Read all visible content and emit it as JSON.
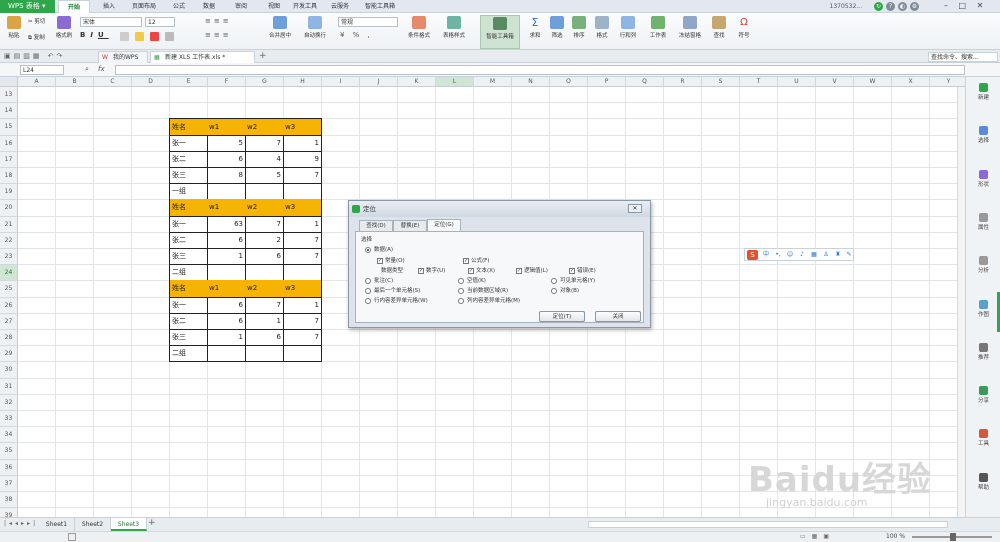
{
  "app": {
    "name": "WPS 表格",
    "account": "1370532...",
    "brand_color": "#2ea64a",
    "header_fill": "#f6b400"
  },
  "menu": [
    "开始",
    "插入",
    "页面布局",
    "公式",
    "数据",
    "审阅",
    "视图",
    "开发工具",
    "云服务",
    "智能工具箱"
  ],
  "ribbon": {
    "paste": "粘贴",
    "cut": "剪切",
    "copy": "复制",
    "format_painter": "格式刷",
    "font_name": "宋体",
    "font_size": "12",
    "merge_center": "合并居中",
    "wrap_text": "自动换行",
    "number_format": "常规",
    "conditional_format": "条件格式",
    "table_style": "表格样式",
    "smart_toolbox": "智能工具箱",
    "sum": "求和",
    "filter": "筛选",
    "sort": "排序",
    "format": "格式",
    "row_col": "行和列",
    "worksheet": "工作表",
    "freeze": "冻结窗格",
    "find": "查找",
    "symbol": "符号",
    "search_cmd": "查找命令、搜索..."
  },
  "doc_tabs": {
    "home": "我的WPS",
    "active": "新建 XLS 工作表.xls *"
  },
  "formula_bar": {
    "name_box": "L24",
    "fx": "fx"
  },
  "columns": [
    "A",
    "B",
    "C",
    "D",
    "E",
    "F",
    "G",
    "H",
    "I",
    "J",
    "K",
    "L",
    "M",
    "N",
    "O",
    "P",
    "Q",
    "R",
    "S",
    "T",
    "U",
    "V",
    "W",
    "X",
    "Y"
  ],
  "selected_column": "L",
  "rows": [
    "13",
    "14",
    "15",
    "16",
    "17",
    "18",
    "19",
    "20",
    "21",
    "22",
    "23",
    "24",
    "25",
    "26",
    "27",
    "28",
    "29",
    "30",
    "31",
    "32",
    "33",
    "34",
    "35",
    "36",
    "37",
    "38",
    "39"
  ],
  "selected_row": "24",
  "table": [
    {
      "row": "15",
      "cells": [
        "姓名",
        "w1",
        "w2",
        "w3"
      ],
      "header": true
    },
    {
      "row": "16",
      "cells": [
        "张一",
        "5",
        "7",
        "1"
      ]
    },
    {
      "row": "17",
      "cells": [
        "张二",
        "6",
        "4",
        "9"
      ]
    },
    {
      "row": "18",
      "cells": [
        "张三",
        "8",
        "5",
        "7"
      ]
    },
    {
      "row": "19",
      "cells": [
        "一组",
        "",
        "",
        ""
      ]
    },
    {
      "row": "20",
      "cells": [
        "姓名",
        "w1",
        "w2",
        "w3"
      ],
      "header": true
    },
    {
      "row": "21",
      "cells": [
        "张一",
        "63",
        "7",
        "1"
      ]
    },
    {
      "row": "22",
      "cells": [
        "张二",
        "6",
        "2",
        "7"
      ]
    },
    {
      "row": "23",
      "cells": [
        "张三",
        "1",
        "6",
        "7"
      ]
    },
    {
      "row": "24",
      "cells": [
        "二组",
        "",
        "",
        ""
      ]
    },
    {
      "row": "25",
      "cells": [
        "姓名",
        "w1",
        "w2",
        "w3"
      ],
      "header": true
    },
    {
      "row": "26",
      "cells": [
        "张一",
        "6",
        "7",
        "1"
      ]
    },
    {
      "row": "27",
      "cells": [
        "张二",
        "6",
        "1",
        "7"
      ]
    },
    {
      "row": "28",
      "cells": [
        "张三",
        "1",
        "6",
        "7"
      ]
    },
    {
      "row": "29",
      "cells": [
        "二组",
        "",
        "",
        ""
      ]
    }
  ],
  "dialog": {
    "title": "定位",
    "tabs": [
      "查找(D)",
      "替换(E)",
      "定位(G)"
    ],
    "group_label": "选择",
    "data_option": "数据(A)",
    "constants": "常量(O)",
    "formulas": "公式(F)",
    "data_type": "数据类型",
    "types": [
      "数字(U)",
      "文本(X)",
      "逻辑值(L)",
      "错误(E)"
    ],
    "options": [
      "批注(C)",
      "空值(K)",
      "可见单元格(Y)",
      "最后一个单元格(S)",
      "当前数据区域(R)",
      "对象(B)",
      "行内容差异单元格(W)",
      "列内容差异单元格(M)"
    ],
    "ok": "定位(T)",
    "close": "关闭"
  },
  "sidebar": [
    "新建",
    "选择",
    "形状",
    "属性",
    "分析",
    "作图",
    "推荐",
    "分享",
    "工具",
    "帮助"
  ],
  "sheets": [
    "Sheet1",
    "Sheet2",
    "Sheet3"
  ],
  "active_sheet": "Sheet3",
  "status": {
    "zoom": "100 %"
  },
  "watermark": {
    "brand": "Baidu经验",
    "url": "jingyan.baidu.com"
  }
}
